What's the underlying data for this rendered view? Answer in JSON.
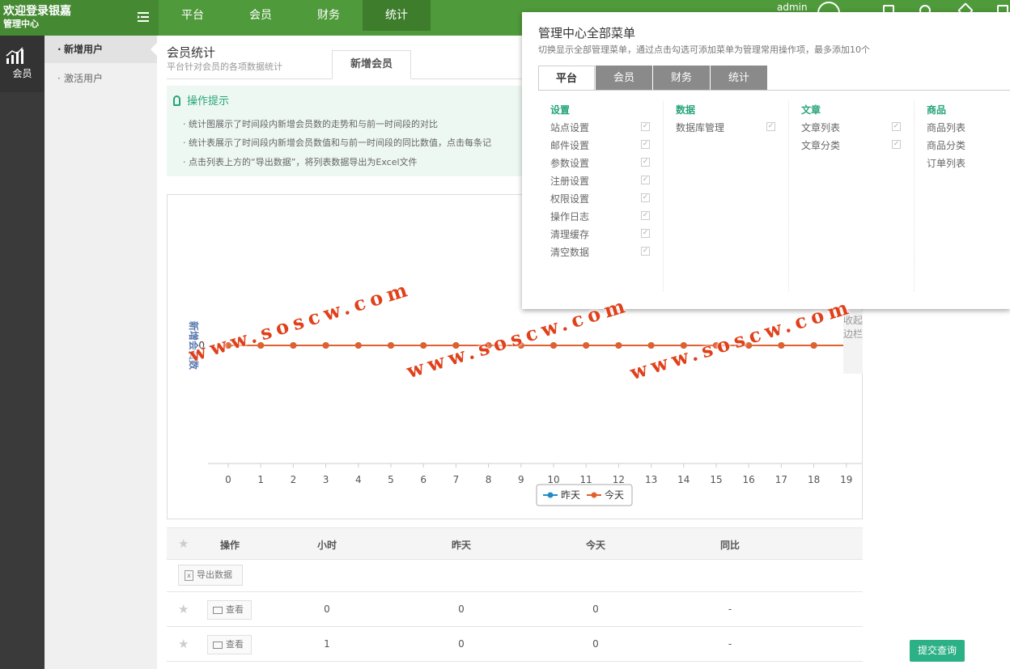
{
  "header": {
    "welcome": "欢迎登录银嘉",
    "center": "管理中心",
    "user": "admin",
    "nav": [
      "平台",
      "会员",
      "财务",
      "统计"
    ],
    "nav_active": 3
  },
  "leftbar": {
    "section": "会员"
  },
  "submenu": {
    "items": [
      "新增用户",
      "激活用户"
    ],
    "active": 0
  },
  "main": {
    "title": "会员统计",
    "subtitle": "平台针对会员的各项数据统计",
    "tab": "新增会员"
  },
  "tips": {
    "heading": "操作提示",
    "items": [
      "统计图展示了时间段内新增会员数的走势和与前一时间段的对比",
      "统计表展示了时间段内新增会员数值和与前一时间段的同比数值，点击每条记",
      "点击列表上方的“导出数据”，将列表数据导出为Excel文件"
    ]
  },
  "chart_data": {
    "type": "line",
    "x": [
      0,
      1,
      2,
      3,
      4,
      5,
      6,
      7,
      8,
      9,
      10,
      11,
      12,
      13,
      14,
      15,
      16,
      17,
      18,
      19
    ],
    "series": [
      {
        "name": "昨天",
        "color": "#1f8ec6",
        "values": [
          0,
          0,
          0,
          0,
          0,
          0,
          0,
          0,
          0,
          0,
          0,
          0,
          0,
          0,
          0,
          0,
          0,
          0,
          0,
          0
        ]
      },
      {
        "name": "今天",
        "color": "#e0602e",
        "values": [
          0,
          0,
          0,
          0,
          0,
          0,
          0,
          0,
          0,
          0,
          0,
          0,
          0,
          0,
          0,
          0,
          0,
          0,
          0,
          0
        ]
      }
    ],
    "ylabel": "新增会员数",
    "yticks": [
      0
    ]
  },
  "table": {
    "headers": [
      "操作",
      "小时",
      "昨天",
      "今天",
      "同比"
    ],
    "export_label": "导出数据",
    "view_label": "查看",
    "rows": [
      {
        "hour": "0",
        "yesterday": "0",
        "today": "0",
        "ratio": "-"
      },
      {
        "hour": "1",
        "yesterday": "0",
        "today": "0",
        "ratio": "-"
      }
    ]
  },
  "sidebar_collapse": "收起边栏",
  "submit_label": "提交查询",
  "panel": {
    "title": "管理中心全部菜单",
    "subtitle": "切换显示全部管理菜单，通过点击勾选可添加菜单为管理常用操作项，最多添加10个",
    "tabs": [
      "平台",
      "会员",
      "财务",
      "统计"
    ],
    "columns": [
      {
        "title": "设置",
        "items": [
          "站点设置",
          "邮件设置",
          "参数设置",
          "注册设置",
          "权限设置",
          "操作日志",
          "清理缓存",
          "清空数据"
        ]
      },
      {
        "title": "数据",
        "items": [
          "数据库管理"
        ]
      },
      {
        "title": "文章",
        "items": [
          "文章列表",
          "文章分类"
        ]
      },
      {
        "title": "商品",
        "items": [
          "商品列表",
          "商品分类",
          "订单列表"
        ]
      }
    ]
  },
  "watermark": "www.soscw.com"
}
